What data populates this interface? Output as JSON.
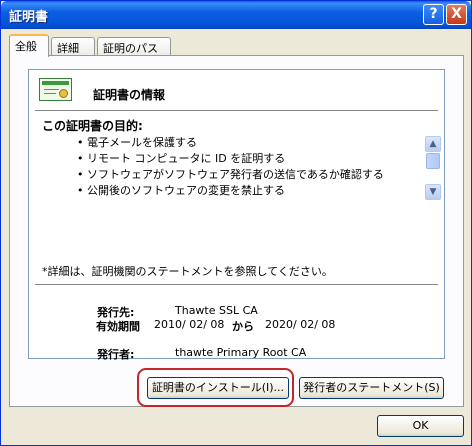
{
  "window": {
    "title": "証明書",
    "help_label": "?",
    "close_label": "X"
  },
  "tabs": [
    {
      "label": "全般",
      "active": true
    },
    {
      "label": "詳細",
      "active": false
    },
    {
      "label": "証明のパス",
      "active": false
    }
  ],
  "info": {
    "title": "証明書の情報",
    "purpose_heading": "この証明書の目的:",
    "purposes": [
      "• 電子メールを保護する",
      "• リモート コンピュータに ID を証明する",
      "• ソフトウェアがソフトウェア発行者の送信であるか確認する",
      "• 公開後のソフトウェアの変更を禁止する"
    ],
    "detail_note": "*詳細は、証明機関のステートメントを参照してください。",
    "issued_to_label": "発行先:",
    "issued_to_value": "Thawte SSL CA",
    "issued_by_label": "発行者:",
    "issued_by_value": "thawte Primary Root CA",
    "validity_label": "有効期間",
    "valid_from": "2010/ 02/ 08",
    "validity_connector": "から",
    "valid_to": "2020/ 02/ 08"
  },
  "scrollbar": {
    "up_icon": "▲",
    "down_icon": "▼"
  },
  "buttons": {
    "install": "証明書のインストール(I)...",
    "statement": "発行者のステートメント(S)",
    "ok": "OK"
  },
  "colors": {
    "titlebar": "#0b5ee2",
    "highlight": "#c0262a",
    "tab_accent": "#f9b84a"
  }
}
